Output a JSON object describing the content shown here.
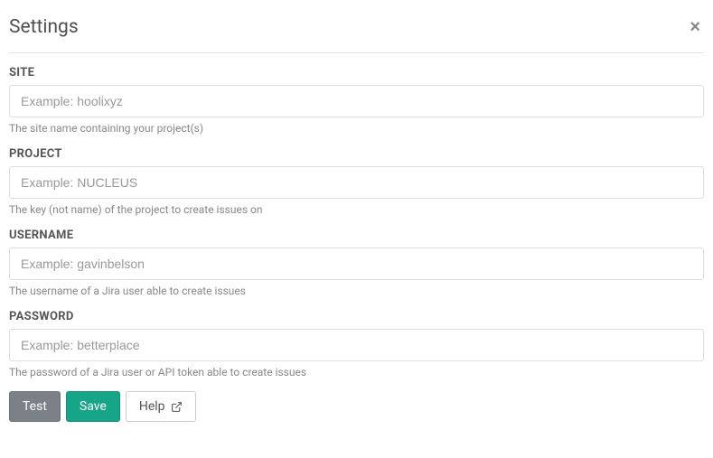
{
  "modal": {
    "title": "Settings",
    "close_label": "×"
  },
  "fields": {
    "site": {
      "label": "SITE",
      "placeholder": "Example: hoolixyz",
      "value": "",
      "help": "The site name containing your project(s)"
    },
    "project": {
      "label": "PROJECT",
      "placeholder": "Example: NUCLEUS",
      "value": "",
      "help": "The key (not name) of the project to create issues on"
    },
    "username": {
      "label": "USERNAME",
      "placeholder": "Example: gavinbelson",
      "value": "",
      "help": "The username of a Jira user able to create issues"
    },
    "password": {
      "label": "PASSWORD",
      "placeholder": "Example: betterplace",
      "value": "",
      "help": "The password of a Jira user or API token able to create issues"
    }
  },
  "buttons": {
    "test": "Test",
    "save": "Save",
    "help": "Help"
  }
}
